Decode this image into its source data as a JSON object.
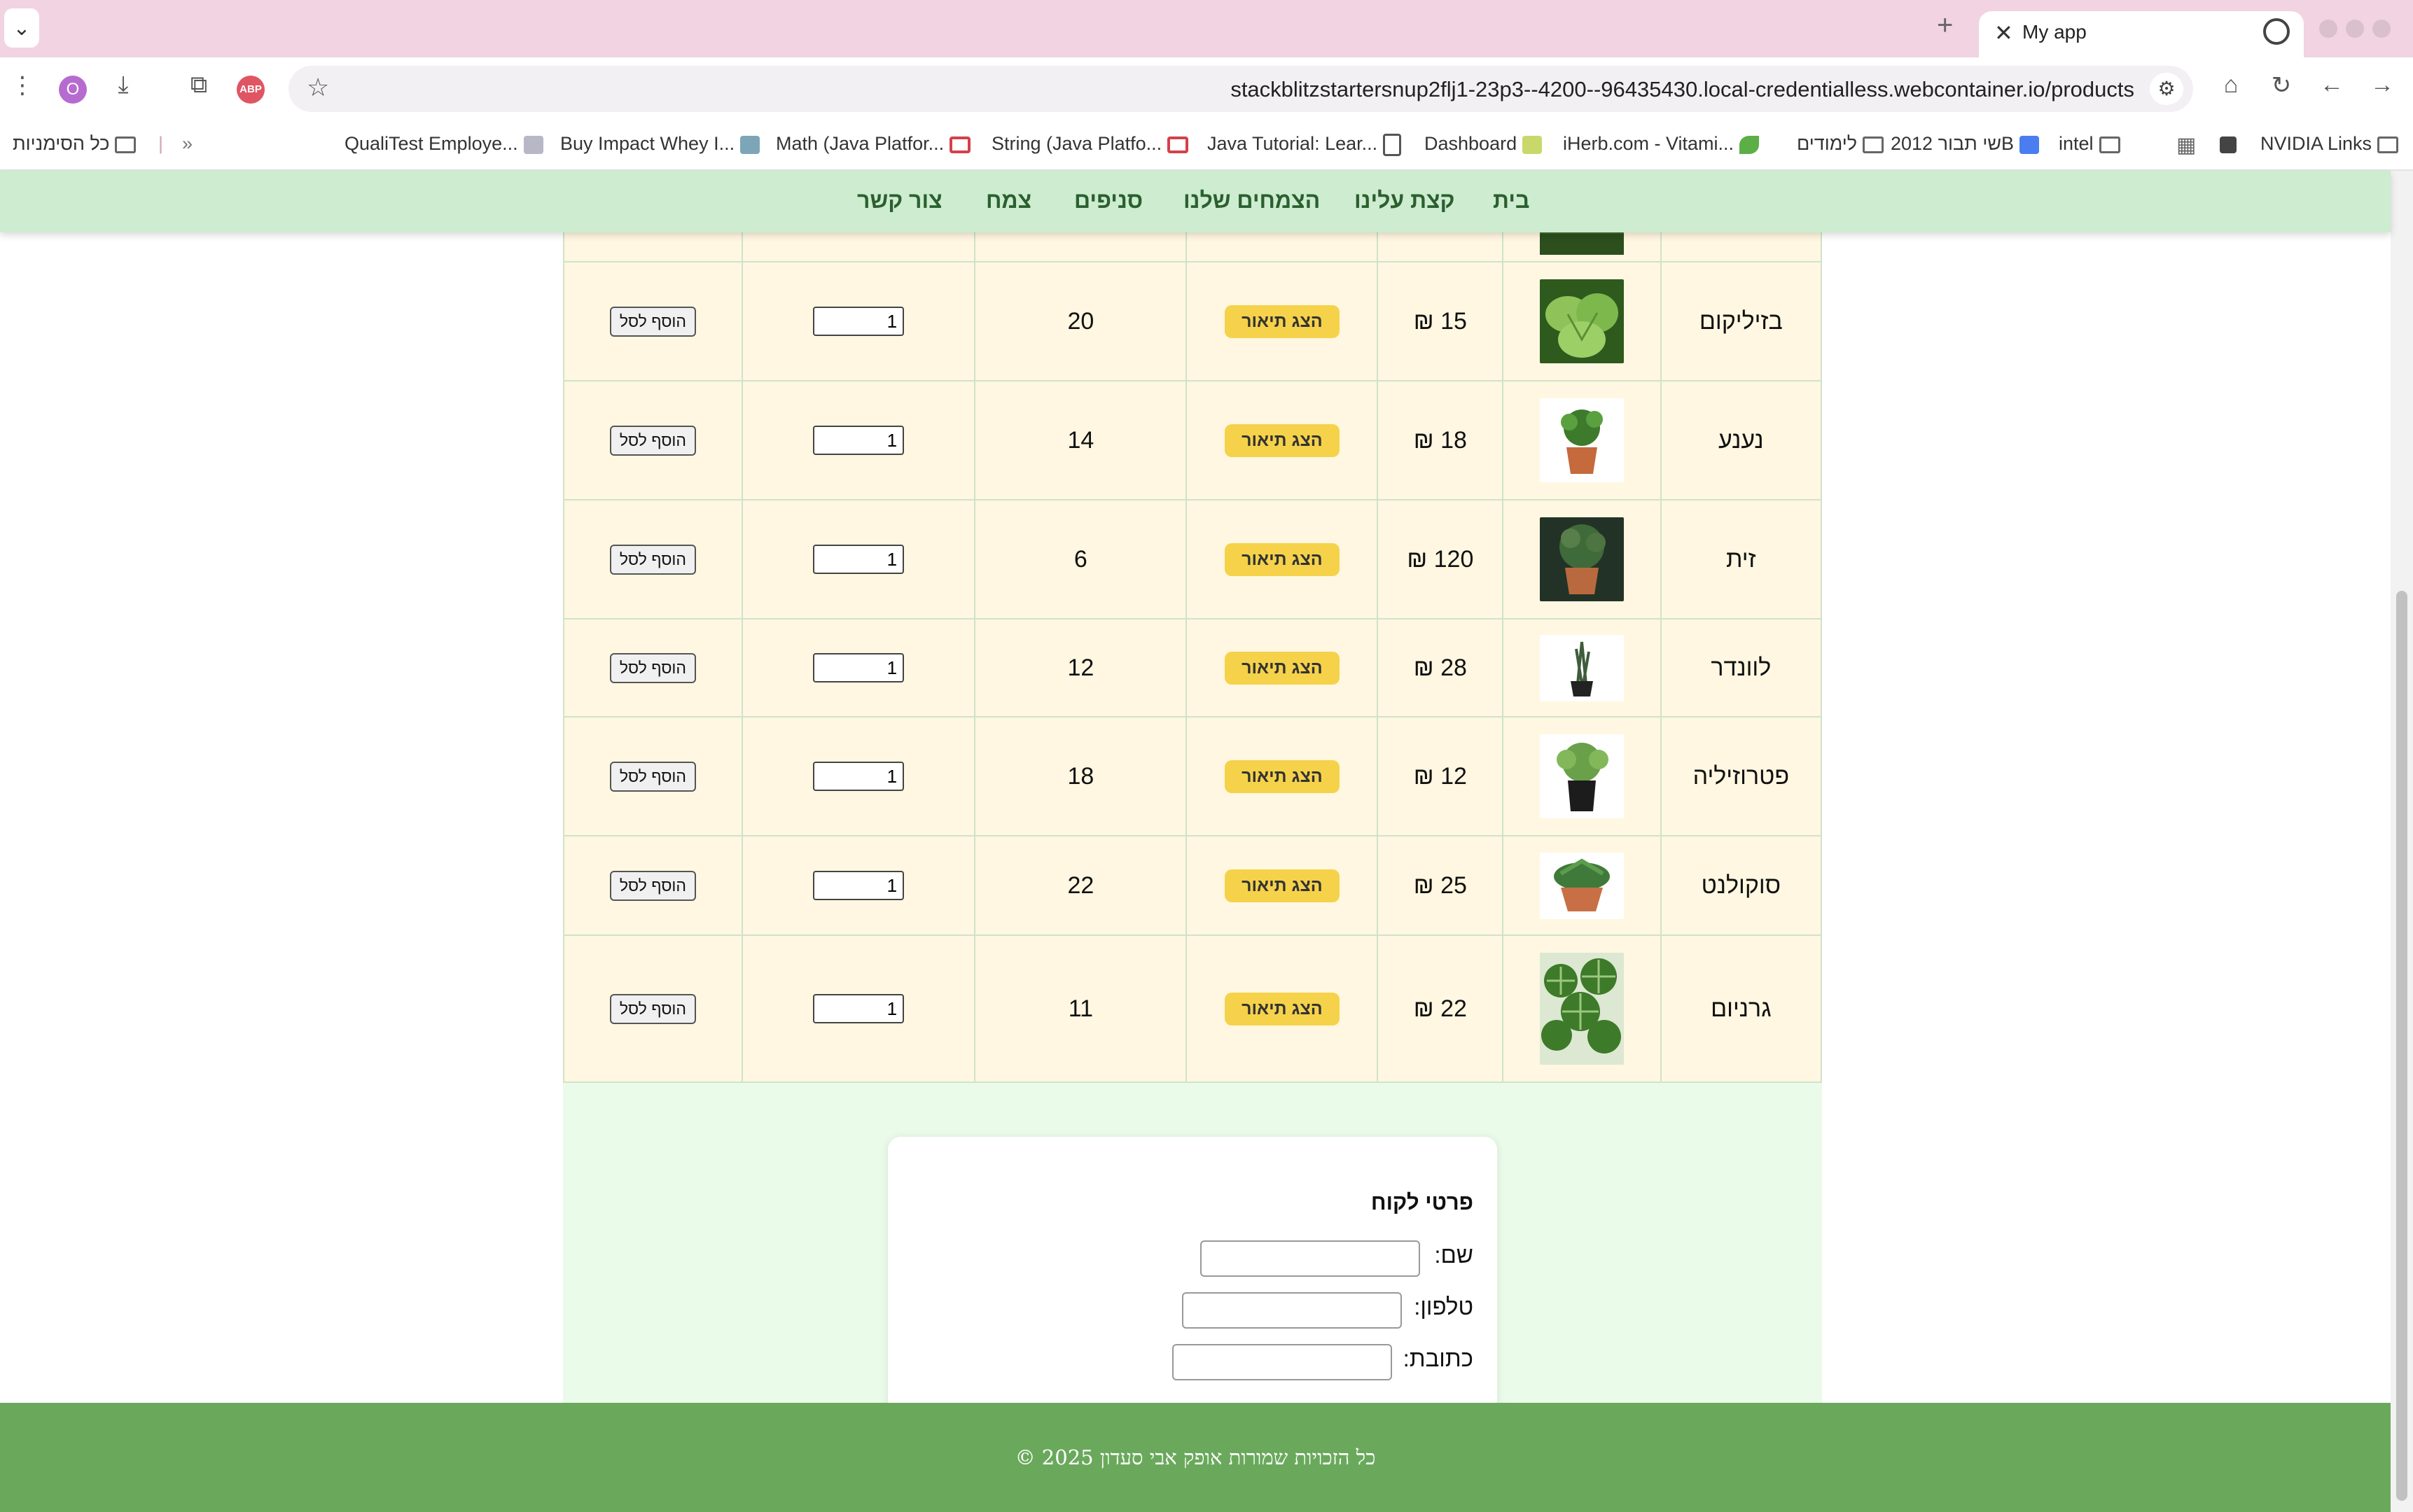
{
  "browser": {
    "tab_title": "My app",
    "new_tab": "+",
    "url": "stackblitzstartersnup2flj1-23p3--4200--96435430.local-credentialless.webcontainer.io/products",
    "avatar_letter": "O",
    "abp_label": "ABP",
    "bookmarks": [
      {
        "label": "NVIDIA Links",
        "icon": "folder-icon"
      },
      {
        "label": "",
        "icon": "bookmark-square-icon"
      },
      {
        "label": "",
        "icon": "apps-grid-icon"
      },
      {
        "label": "intel",
        "icon": "folder-icon"
      },
      {
        "label": "שי תבור 2012B",
        "icon": "dropbox-icon"
      },
      {
        "label": "לימודים",
        "icon": "folder-icon"
      },
      {
        "label": "iHerb.com - Vitami...",
        "icon": "leaf-icon"
      },
      {
        "label": "Dashboard",
        "icon": "site-icon"
      },
      {
        "label": "Java Tutorial: Lear...",
        "icon": "doc-icon"
      },
      {
        "label": "String (Java Platfo...",
        "icon": "oracle-icon"
      },
      {
        "label": "Math (Java Platfor...",
        "icon": "oracle-icon"
      },
      {
        "label": "Buy Impact Whey I...",
        "icon": "site-icon"
      },
      {
        "label": "QualiTest Employe...",
        "icon": "site-icon"
      }
    ],
    "bookmarks_overflow": "»",
    "all_bookmarks": "כל הסימניות"
  },
  "nav": {
    "items": [
      "בית",
      "קצת עלינו",
      "הצמחים שלנו",
      "סניפים",
      "צמח",
      "צור קשר"
    ]
  },
  "products": {
    "currency": "₪",
    "desc_button": "הצג תיאור",
    "add_button": "הוסף לסל",
    "rows": [
      {
        "name": "בזיליקום",
        "price": "15",
        "stock": "20",
        "qty": "1",
        "img": "basil"
      },
      {
        "name": "נענע",
        "price": "18",
        "stock": "14",
        "qty": "1",
        "img": "mint"
      },
      {
        "name": "זית",
        "price": "120",
        "stock": "6",
        "qty": "1",
        "img": "olive"
      },
      {
        "name": "לוונדר",
        "price": "28",
        "stock": "12",
        "qty": "1",
        "img": "lavender"
      },
      {
        "name": "פטרוזיליה",
        "price": "12",
        "stock": "18",
        "qty": "1",
        "img": "parsley"
      },
      {
        "name": "סוקולנט",
        "price": "25",
        "stock": "22",
        "qty": "1",
        "img": "succulent"
      },
      {
        "name": "גרניום",
        "price": "22",
        "stock": "11",
        "qty": "1",
        "img": "geranium"
      }
    ]
  },
  "customer": {
    "title": "פרטי לקוח",
    "name_label": "שם:",
    "phone_label": "טלפון:",
    "address_label": "כתובת:"
  },
  "footer": {
    "text": "כל הזכויות שמורות אופק אבי סעדון 2025 ©"
  },
  "colors": {
    "nav_bg": "#cdecd0",
    "row_bg": "#fff7e1",
    "desc_btn": "#f5d24a",
    "footer_bg": "#6aa95c"
  }
}
